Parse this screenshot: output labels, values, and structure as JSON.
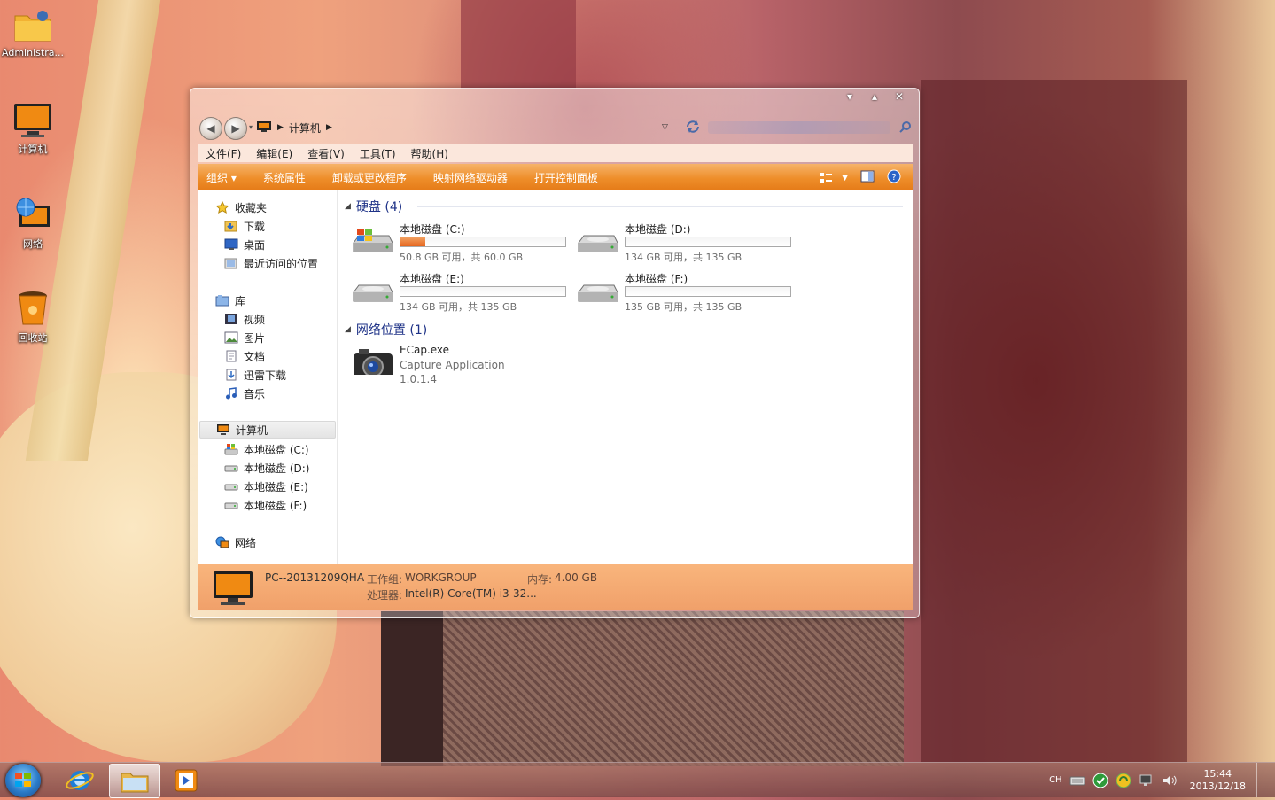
{
  "desktop": {
    "icons": [
      {
        "label": "Administra..."
      },
      {
        "label": "计算机"
      },
      {
        "label": "网络"
      },
      {
        "label": "回收站"
      }
    ]
  },
  "window": {
    "caption_buttons": {
      "minimize": "▾",
      "maximize": "▴",
      "close": "✕"
    },
    "address": {
      "root_icon": "computer-icon",
      "path": [
        "计算机"
      ]
    },
    "menu": [
      "文件(F)",
      "编辑(E)",
      "查看(V)",
      "工具(T)",
      "帮助(H)"
    ],
    "commands": [
      "组织 ▾",
      "系统属性",
      "卸载或更改程序",
      "映射网络驱动器",
      "打开控制面板"
    ],
    "nav": {
      "favorites": {
        "label": "收藏夹",
        "items": [
          "下载",
          "桌面",
          "最近访问的位置"
        ]
      },
      "libraries": {
        "label": "库",
        "items": [
          "视频",
          "图片",
          "文档",
          "迅雷下载",
          "音乐"
        ]
      },
      "computer": {
        "label": "计算机",
        "items": [
          "本地磁盘 (C:)",
          "本地磁盘 (D:)",
          "本地磁盘 (E:)",
          "本地磁盘 (F:)"
        ]
      },
      "network": {
        "label": "网络"
      }
    },
    "groups": {
      "hard_disks": {
        "title": "硬盘 (4)",
        "drives": [
          {
            "name": "本地磁盘 (C:)",
            "free_text": "50.8 GB 可用，共 60.0 GB",
            "used_fraction": 0.15,
            "system": true
          },
          {
            "name": "本地磁盘 (D:)",
            "free_text": "134 GB 可用，共 135 GB",
            "used_fraction": 0.0,
            "system": false
          },
          {
            "name": "本地磁盘 (E:)",
            "free_text": "134 GB 可用，共 135 GB",
            "used_fraction": 0.0,
            "system": false
          },
          {
            "name": "本地磁盘 (F:)",
            "free_text": "135 GB 可用，共 135 GB",
            "used_fraction": 0.0,
            "system": false
          }
        ]
      },
      "network_locations": {
        "title": "网络位置 (1)",
        "items": [
          {
            "name": "ECap.exe",
            "desc": "Capture Application",
            "version": "1.0.1.4"
          }
        ]
      }
    },
    "status": {
      "pc_name": "PC--20131209QHA",
      "workgroup_label": "工作组:",
      "workgroup": "WORKGROUP",
      "memory_label": "内存:",
      "memory": "4.00 GB",
      "cpu_label": "处理器:",
      "cpu": "Intel(R) Core(TM) i3-32..."
    }
  },
  "taskbar": {
    "tray_lang": "CH",
    "time": "15:44",
    "date": "2013/12/18"
  },
  "colors": {
    "accent_orange": "#ee8e2a",
    "link_blue": "#1e3287",
    "drive_fill": "#e5661e"
  }
}
